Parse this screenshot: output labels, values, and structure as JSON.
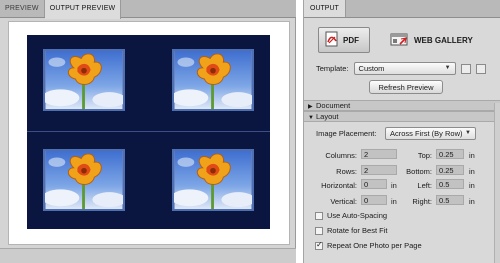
{
  "preview_tabs": [
    "PREVIEW",
    "OUTPUT PREVIEW"
  ],
  "output_tab": "OUTPUT",
  "buttons": {
    "pdf": "PDF",
    "web_gallery": "WEB GALLERY",
    "refresh_preview": "Refresh Preview"
  },
  "template": {
    "label": "Template:",
    "value": "Custom"
  },
  "sections": {
    "document": "Document",
    "layout": "Layout"
  },
  "layout": {
    "image_placement_label": "Image Placement:",
    "image_placement_value": "Across First (By Row)",
    "columns_label": "Columns:",
    "columns_value": "2",
    "rows_label": "Rows:",
    "rows_value": "2",
    "horizontal_label": "Horizontal:",
    "horizontal_value": "0",
    "vertical_label": "Vertical:",
    "vertical_value": "0",
    "top_label": "Top:",
    "top_value": "0.25",
    "bottom_label": "Bottom:",
    "bottom_value": "0.25",
    "left_label": "Left:",
    "left_value": "0.5",
    "right_label": "Right:",
    "right_value": "0.5",
    "unit": "in"
  },
  "options": [
    {
      "label": "Use Auto-Spacing",
      "checked": false
    },
    {
      "label": "Rotate for Best Fit",
      "checked": false
    },
    {
      "label": "Repeat One Photo per Page",
      "checked": true
    }
  ],
  "colors": {
    "sheet_background": "#0a1640",
    "photo_border": "#4f6fb3",
    "pdf_icon_red": "#cc2222"
  },
  "icons": {
    "pdf": "pdf-icon",
    "web_gallery": "web-gallery-icon",
    "save_template": "save-template-icon",
    "delete_template": "delete-template-icon"
  }
}
